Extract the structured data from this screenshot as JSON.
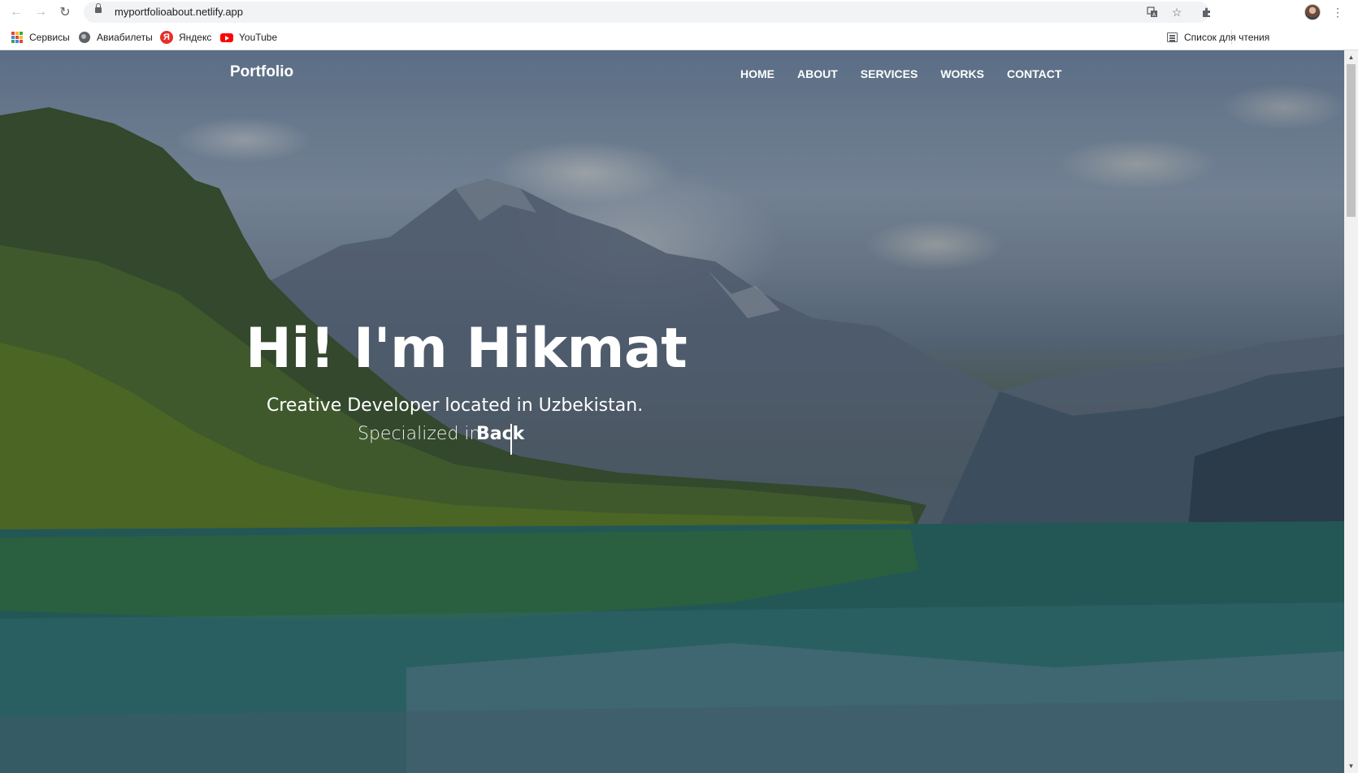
{
  "browser": {
    "url": "myportfolioabout.netlify.app",
    "bookmarks": [
      {
        "label": "Сервисы",
        "icon": "apps-grid-icon"
      },
      {
        "label": "Авиабилеты",
        "icon": "globe-icon"
      },
      {
        "label": "Яндекс",
        "icon": "yandex-icon"
      },
      {
        "label": "YouTube",
        "icon": "youtube-icon"
      }
    ],
    "reading_list_label": "Список для чтения",
    "yandex_letter": "Я"
  },
  "site": {
    "brand": "Portfolio",
    "nav": [
      "HOME",
      "ABOUT",
      "SERVICES",
      "WORKS",
      "CONTACT"
    ],
    "hero": {
      "title": "Hi! I'm Hikmat",
      "subtitle": "Creative Developer located in Uzbekistan.",
      "specialized_prefix": "Specialized in",
      "typed_text": "Back"
    }
  },
  "colors": {
    "apps_grid": [
      "#ea4335",
      "#fbbc04",
      "#34a853",
      "#4285f4",
      "#ea4335",
      "#fbbc04",
      "#34a853",
      "#4285f4",
      "#ea4335"
    ]
  }
}
